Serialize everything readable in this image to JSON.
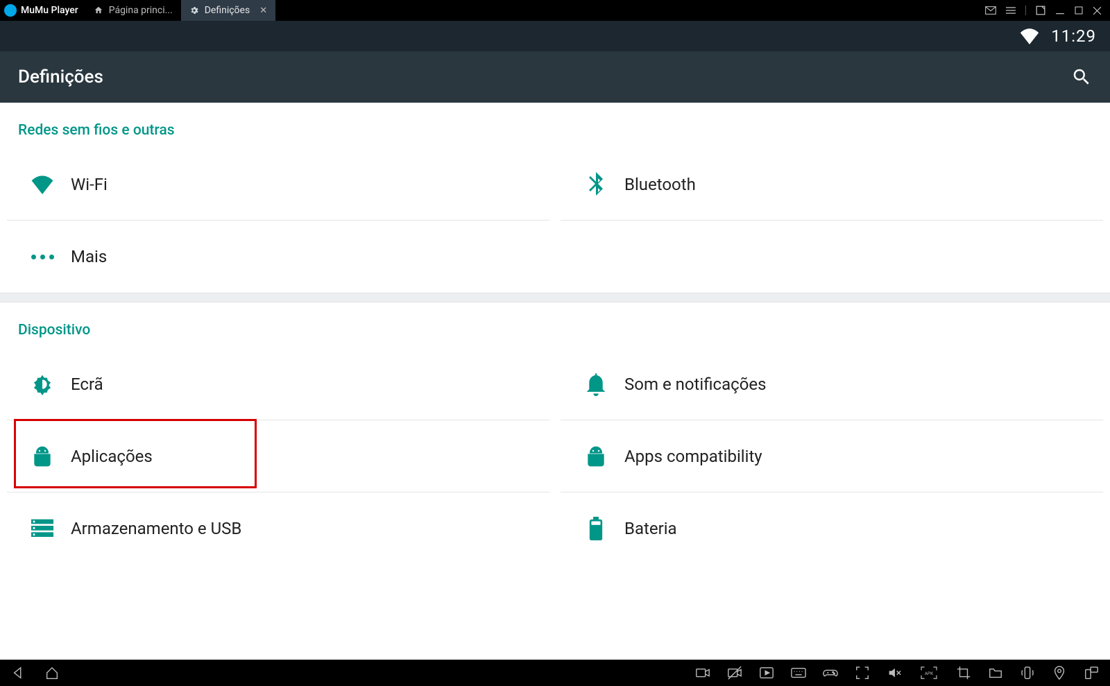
{
  "window": {
    "app_name": "MuMu Player",
    "tabs": {
      "home_label": "Página princi...",
      "active_label": "Definições"
    }
  },
  "status": {
    "time": "11:29"
  },
  "header": {
    "title": "Definições"
  },
  "sections": {
    "wireless": {
      "title": "Redes sem fios e outras",
      "items": {
        "wifi": "Wi-Fi",
        "bluetooth": "Bluetooth",
        "more": "Mais"
      }
    },
    "device": {
      "title": "Dispositivo",
      "items": {
        "display": "Ecrã",
        "sound": "Som e notificações",
        "apps": "Aplicações",
        "apps_compat": "Apps compatibility",
        "storage": "Armazenamento e USB",
        "battery": "Bateria"
      }
    }
  },
  "colors": {
    "teal": "#009688",
    "header_bg": "#2a373f",
    "highlight": "#d60000"
  }
}
